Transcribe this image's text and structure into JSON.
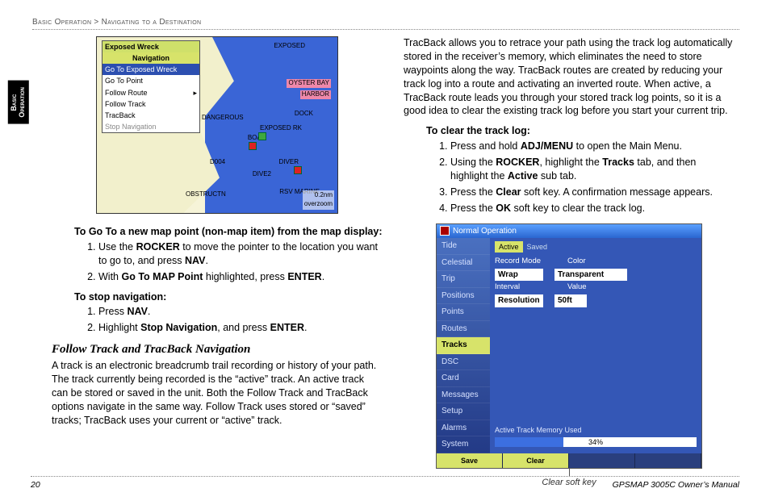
{
  "header": {
    "breadcrumb": "Basic Operation > Navigating to a Destination"
  },
  "side_tab": {
    "line1": "Basic",
    "line2": "Operation"
  },
  "map_fig": {
    "title_bar": "Exposed Wreck",
    "menu": {
      "heading": "Navigation",
      "items": [
        {
          "label": "Go To Exposed Wreck",
          "sel": true
        },
        {
          "label": "Go To Point"
        },
        {
          "label": "Follow Route",
          "arrow": true
        },
        {
          "label": "Follow Track"
        },
        {
          "label": "TracBack"
        },
        {
          "label": "Stop Navigation",
          "dim": true
        }
      ]
    },
    "labels": [
      "EXPOSED",
      "DIVER",
      "DOCK",
      "BOAT",
      "DIVE2",
      "DANGEROUS",
      "OYSTER BAY",
      "HARBOR",
      "EXPOSED RK",
      "OBSTRUCTN",
      "RSV MARINE",
      "D004"
    ],
    "scale": "0.2nm",
    "overzoom": "overzoom"
  },
  "left": {
    "h1": "To Go To a new map point (non-map item) from the map display:",
    "s1a": "Use the ",
    "s1b": "ROCKER",
    "s1c": " to move the pointer to the location you want to go to, and press ",
    "s1d": "NAV",
    "s1e": ".",
    "s2a": "With ",
    "s2b": "Go To MAP Point",
    "s2c": " highlighted, press ",
    "s2d": "ENTER",
    "s2e": ".",
    "h2": "To stop navigation:",
    "t1a": "Press ",
    "t1b": "NAV",
    "t1c": ".",
    "t2a": "Highlight ",
    "t2b": "Stop Navigation",
    "t2c": ", and press ",
    "t2d": "ENTER",
    "t2e": ".",
    "sect": "Follow Track and TracBack Navigation",
    "para": "A track is an electronic breadcrumb trail recording or history of your path. The track currently being recorded is the “active” track. An active track can be stored or saved in the unit. Both the Follow Track and TracBack options navigate in the same way. Follow Track uses stored or “saved” tracks; TracBack uses your current or “active” track."
  },
  "right": {
    "intro": "TracBack allows you to retrace your path using the track log automatically stored in the receiver’s memory, which eliminates the need to store waypoints along the way. TracBack routes are created by reducing your track log into a route and activating an inverted route. When active, a TracBack route leads you through your stored track log points, so it is a good idea to clear the existing track log before you start your current trip.",
    "h1": "To clear the track log:",
    "c1a": "Press and hold ",
    "c1b": "ADJ/MENU",
    "c1c": " to open the Main Menu.",
    "c2a": "Using the ",
    "c2b": "ROCKER",
    "c2c": ", highlight the ",
    "c2d": "Tracks",
    "c2e": " tab, and then highlight the ",
    "c2f": "Active",
    "c2g": " sub tab.",
    "c3a": "Press the ",
    "c3b": "Clear",
    "c3c": " soft key. A confirmation message appears.",
    "c4a": "Press the ",
    "c4b": "OK",
    "c4c": " soft key to clear the track log."
  },
  "screen": {
    "title": "Normal Operation",
    "tabs": [
      "Tide",
      "Celestial",
      "Trip",
      "Positions",
      "Points",
      "Routes",
      "Tracks",
      "DSC",
      "Card",
      "Messages",
      "Setup",
      "Alarms",
      "System"
    ],
    "tabs_sel": "Tracks",
    "subtab_active": "Active",
    "subtab_saved": "Saved",
    "rows": [
      {
        "l": "Record Mode",
        "v": "Wrap",
        "r": "Color",
        "rv": "Transparent"
      },
      {
        "l": "Interval",
        "v": "Resolution",
        "r": "Value",
        "rv": "50ft"
      }
    ],
    "row_record": "Record Mode",
    "row_color": "Color",
    "val_wrap": "Wrap",
    "val_transparent": "Transparent",
    "row_interval": "Interval",
    "row_value": "Value",
    "val_resolution": "Resolution",
    "val_50ft": "50ft",
    "mem_label": "Active Track Memory Used",
    "mem_pct": "34%",
    "soft": [
      "Save",
      "Clear",
      "",
      ""
    ],
    "caption": "Clear soft key"
  },
  "footer": {
    "page": "20",
    "manual": "GPSMAP 3005C Owner’s Manual"
  }
}
